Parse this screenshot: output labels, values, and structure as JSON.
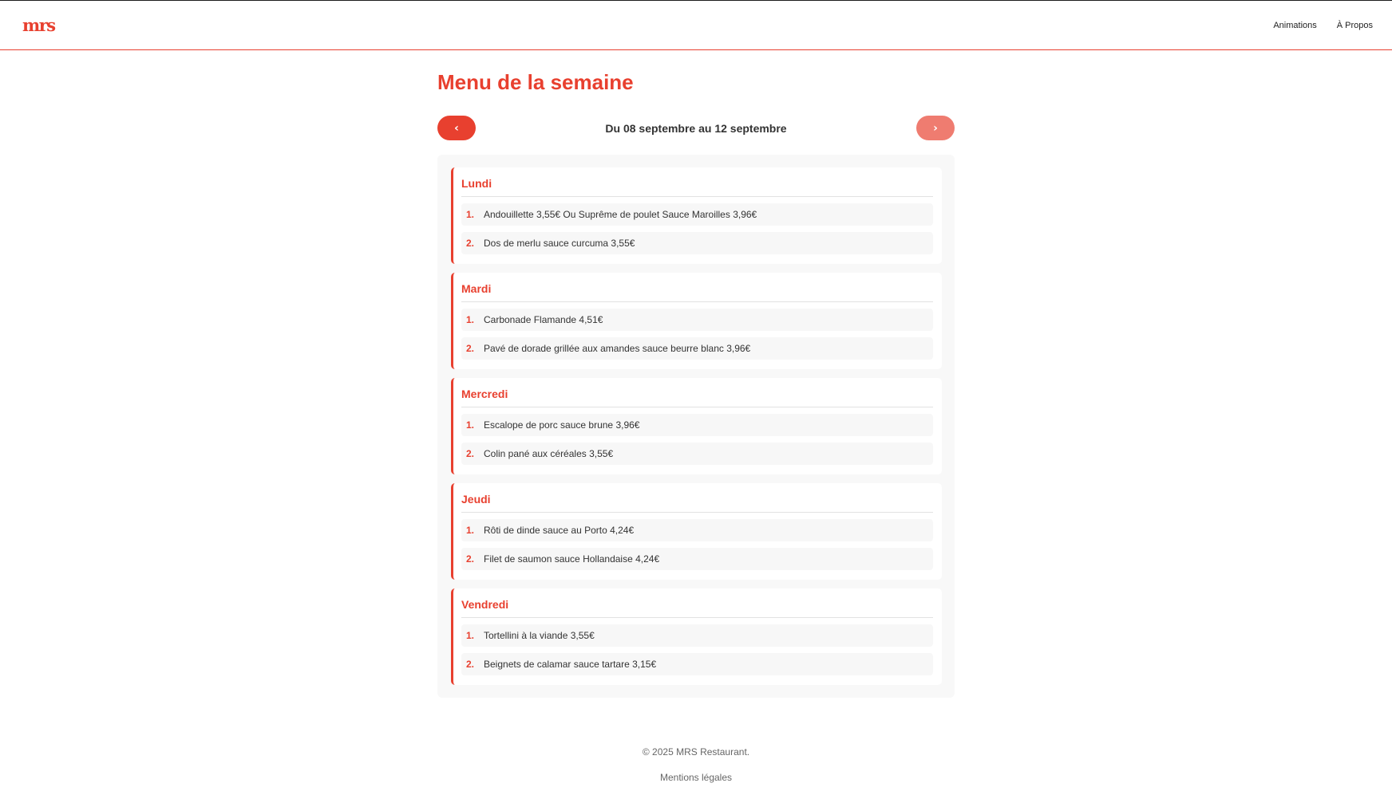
{
  "header": {
    "logo": "mrs",
    "nav": [
      "Animations",
      "À Propos"
    ]
  },
  "main": {
    "title": "Menu de la semaine",
    "week_nav": {
      "prev_label": "‹",
      "next_label": "›",
      "range": "Du 08 septembre au 12 septembre"
    },
    "days": [
      {
        "name": "Lundi",
        "dishes": [
          {
            "num": "1.",
            "text": "Andouillette 3,55€ Ou Suprême de poulet Sauce Maroilles 3,96€"
          },
          {
            "num": "2.",
            "text": "Dos de merlu sauce curcuma 3,55€"
          }
        ]
      },
      {
        "name": "Mardi",
        "dishes": [
          {
            "num": "1.",
            "text": "Carbonade Flamande 4,51€"
          },
          {
            "num": "2.",
            "text": "Pavé de dorade grillée aux amandes sauce beurre blanc 3,96€"
          }
        ]
      },
      {
        "name": "Mercredi",
        "dishes": [
          {
            "num": "1.",
            "text": "Escalope de porc sauce brune 3,96€"
          },
          {
            "num": "2.",
            "text": "Colin pané aux céréales 3,55€"
          }
        ]
      },
      {
        "name": "Jeudi",
        "dishes": [
          {
            "num": "1.",
            "text": "Rôti de dinde sauce au Porto 4,24€"
          },
          {
            "num": "2.",
            "text": "Filet de saumon sauce Hollandaise 4,24€"
          }
        ]
      },
      {
        "name": "Vendredi",
        "dishes": [
          {
            "num": "1.",
            "text": "Tortellini à la viande 3,55€"
          },
          {
            "num": "2.",
            "text": "Beignets de calamar sauce tartare 3,15€"
          }
        ]
      }
    ]
  },
  "footer": {
    "copyright": "© 2025 MRS Restaurant.",
    "legal": "Mentions légales"
  },
  "colors": {
    "accent": "#e8402f",
    "accent_light": "#ef7c70",
    "panel_bg": "#f8f8f8",
    "dish_bg": "#f7f7f7"
  }
}
